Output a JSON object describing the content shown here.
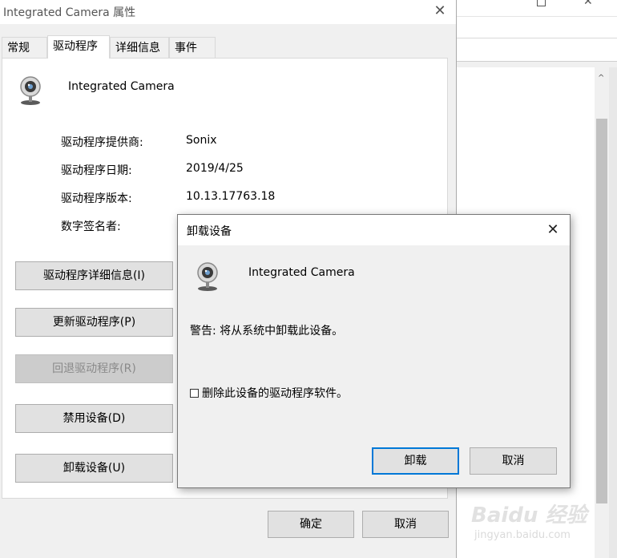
{
  "background_window": {
    "minimize_glyph": "—",
    "close_glyph": "✕",
    "scroll_up_glyph": "^"
  },
  "properties": {
    "title": "Integrated Camera 属性",
    "close_glyph": "✕",
    "tabs": [
      {
        "label": "常规"
      },
      {
        "label": "驱动程序"
      },
      {
        "label": "详细信息"
      },
      {
        "label": "事件"
      }
    ],
    "device_name": "Integrated Camera",
    "info": [
      {
        "label": "驱动程序提供商:",
        "value": "Sonix"
      },
      {
        "label": "驱动程序日期:",
        "value": "2019/4/25"
      },
      {
        "label": "驱动程序版本:",
        "value": "10.13.17763.18"
      },
      {
        "label": "数字签名者:",
        "value": ""
      }
    ],
    "buttons": {
      "details": "驱动程序详细信息(I)",
      "update": "更新驱动程序(P)",
      "rollback": "回退驱动程序(R)",
      "disable": "禁用设备(D)",
      "uninstall": "卸载设备(U)"
    },
    "footer": {
      "ok": "确定",
      "cancel": "取消"
    }
  },
  "uninstall_dialog": {
    "title": "卸载设备",
    "close_glyph": "✕",
    "device_name": "Integrated Camera",
    "warning": "警告: 将从系统中卸载此设备。",
    "checkbox_label": "删除此设备的驱动程序软件。",
    "checkbox_checked": false,
    "uninstall_button": "卸载",
    "cancel_button": "取消"
  },
  "watermark": {
    "main": "Baidu 经验",
    "sub": "jingyan.baidu.com"
  }
}
